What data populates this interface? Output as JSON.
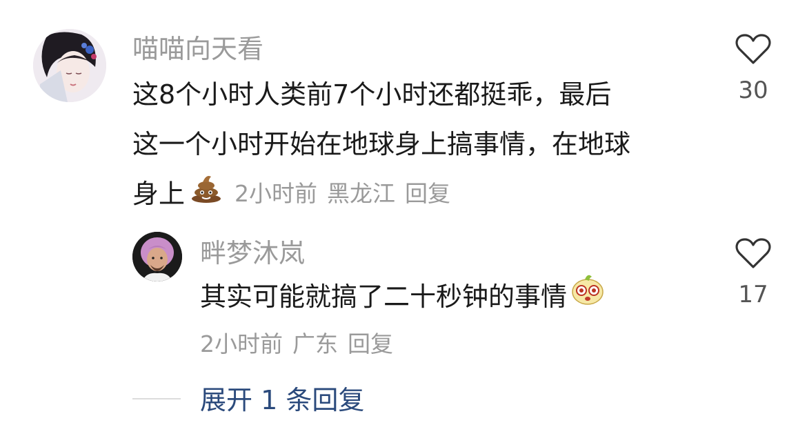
{
  "comments": [
    {
      "username": "喵喵向天看",
      "text_lines": [
        "这8个小时人类前7个小时还都挺乖，最后",
        "这一个小时开始在地球身上搞事情，在地球",
        "身上"
      ],
      "emoji": "poop",
      "time": "2小时前",
      "location": "黑龙江",
      "reply_label": "回复",
      "likes": "30"
    },
    {
      "username": "畔梦沐岚",
      "text_lines": [
        "其实可能就搞了二十秒钟的事情"
      ],
      "emoji": "dizzy-face",
      "time": "2小时前",
      "location": "广东",
      "reply_label": "回复",
      "likes": "17"
    }
  ],
  "expand_replies": "展开 1 条回复",
  "colors": {
    "username": "#9a9a9a",
    "meta": "#9a9a9a",
    "link": "#2b4a7c",
    "text": "#1a1a1a"
  }
}
